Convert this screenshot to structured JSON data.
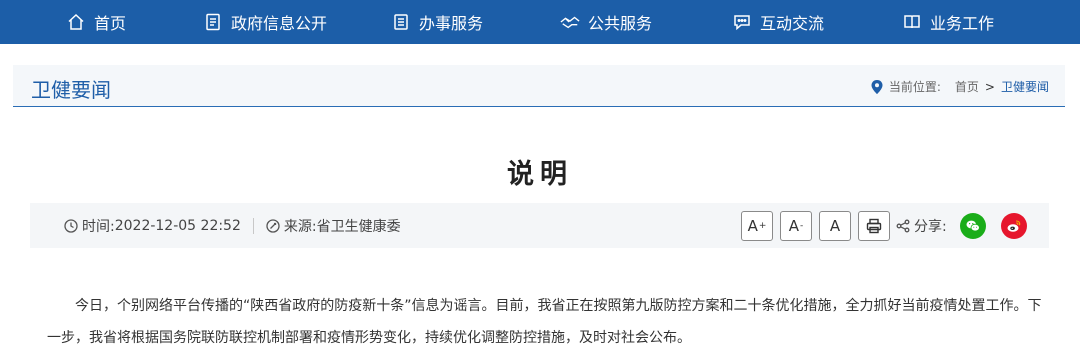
{
  "nav": {
    "items": [
      {
        "label": "首页",
        "icon": "home-icon"
      },
      {
        "label": "政府信息公开",
        "icon": "document-icon"
      },
      {
        "label": "办事服务",
        "icon": "clipboard-icon"
      },
      {
        "label": "公共服务",
        "icon": "handshake-icon"
      },
      {
        "label": "互动交流",
        "icon": "chat-icon"
      },
      {
        "label": "业务工作",
        "icon": "book-icon"
      }
    ]
  },
  "section": {
    "title": "卫健要闻",
    "breadcrumb": {
      "prefix": "当前位置:",
      "home": "首页",
      "separator": ">",
      "current": "卫健要闻"
    }
  },
  "article": {
    "title": "说明",
    "meta": {
      "time_label": "时间:",
      "time_value": "2022-12-05 22:52",
      "source_label": "来源:",
      "source_value": "省卫生健康委"
    },
    "tools": {
      "font_large": "A",
      "font_large_sup": "+",
      "font_small": "A",
      "font_small_sup": "-",
      "font_normal": "A",
      "share_label": "分享:"
    },
    "body": "今日，个别网络平台传播的“陕西省政府的防疫新十条”信息为谣言。目前，我省正在按照第九版防控方案和二十条优化措施，全力抓好当前疫情处置工作。下一步，我省将根据国务院联防联控机制部署和疫情形势变化，持续优化调整防控措施，及时对社会公布。"
  },
  "colors": {
    "nav_bg": "#1c5ea8",
    "accent": "#1f5ea8",
    "wechat": "#1aad19",
    "weibo": "#e6162d"
  }
}
